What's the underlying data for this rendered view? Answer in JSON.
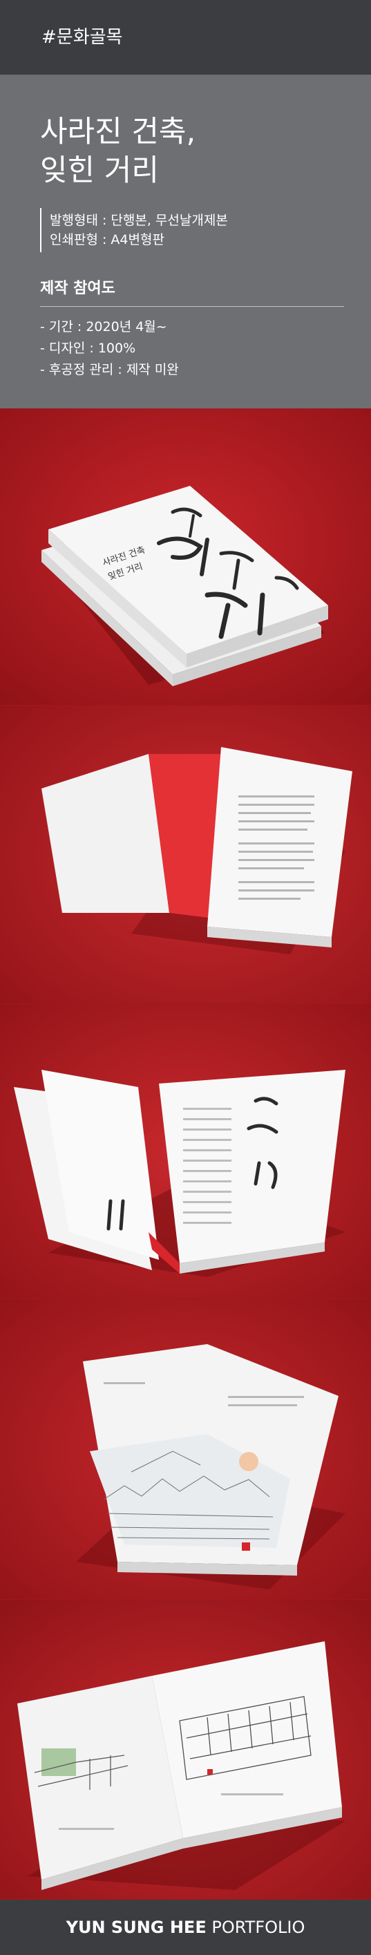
{
  "header": {
    "tag": "#문화골목"
  },
  "book": {
    "title_line1": "사라진 건축,",
    "title_line2": "잊힌 거리",
    "specs": [
      "발행형태 : 단행본, 무선날개제본",
      "인쇄판형 : A4변형판"
    ]
  },
  "participation": {
    "heading": "제작 참여도",
    "items": [
      "- 기간 : 2020년 4월~",
      "- 디자인 : 100%",
      "- 후공정 관리 : 제작 미완"
    ]
  },
  "mockup_cover": {
    "title_line1": "사라진 건축",
    "title_line2": "잊힌 거리"
  },
  "colors": {
    "topbar": "#3c3d40",
    "info_panel": "#6e6f72",
    "background_red": "#b81d22",
    "accent_red": "#d4262c"
  },
  "footer": {
    "name": "YUN SUNG HEE",
    "portfolio": "PORTFOLIO"
  }
}
